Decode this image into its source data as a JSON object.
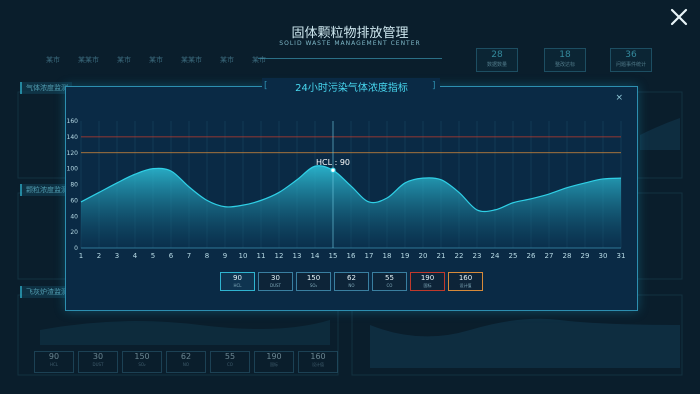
{
  "header": {
    "title": "固体颗粒物排放管理",
    "subtitle": "SOLID WASTE MANAGEMENT CENTER"
  },
  "city_nav": [
    "某市",
    "某某市",
    "某市",
    "某市",
    "某某市",
    "某市",
    "某市"
  ],
  "stats": [
    {
      "value": "28",
      "label": "数据数量"
    },
    {
      "value": "18",
      "label": "整改达标"
    },
    {
      "value": "36",
      "label": "问题事件统计"
    }
  ],
  "panels": {
    "left_1": "气体浓度监测",
    "left_2": "颗粒浓度监测",
    "left_3": "飞灰炉渣监测"
  },
  "modal": {
    "title": "24小时污染气体浓度指标",
    "close": "×",
    "tooltip": "HCL : 90"
  },
  "metrics": [
    {
      "value": "90",
      "name": "HCL",
      "state": "active"
    },
    {
      "value": "30",
      "name": "DUST",
      "state": "normal"
    },
    {
      "value": "150",
      "name": "SO₂",
      "state": "normal"
    },
    {
      "value": "62",
      "name": "NO",
      "state": "normal"
    },
    {
      "value": "55",
      "name": "CO",
      "state": "normal"
    },
    {
      "value": "190",
      "name": "国标",
      "state": "red"
    },
    {
      "value": "160",
      "name": "设计值",
      "state": "orange"
    }
  ],
  "bg_metrics": [
    {
      "value": "90",
      "name": "HCL"
    },
    {
      "value": "30",
      "name": "DUST"
    },
    {
      "value": "150",
      "name": "SO₂"
    },
    {
      "value": "62",
      "name": "NO"
    },
    {
      "value": "55",
      "name": "CO"
    },
    {
      "value": "190",
      "name": "国标"
    },
    {
      "value": "160",
      "name": "设计值"
    }
  ],
  "colors": {
    "accent": "#48d8f0",
    "line": "#2fd0e6",
    "threshold_red": "#c0392b",
    "threshold_orange": "#d68a3a"
  },
  "chart_data": {
    "type": "area",
    "x": [
      1,
      2,
      3,
      4,
      5,
      6,
      7,
      8,
      9,
      10,
      11,
      12,
      13,
      14,
      15,
      16,
      17,
      18,
      19,
      20,
      21,
      22,
      23,
      24,
      25,
      26,
      27,
      28,
      29,
      30,
      31
    ],
    "series": [
      {
        "name": "HCL",
        "values": [
          58,
          70,
          82,
          93,
          100,
          97,
          77,
          60,
          52,
          54,
          60,
          70,
          86,
          103,
          98,
          78,
          58,
          63,
          82,
          88,
          86,
          70,
          48,
          48,
          57,
          62,
          68,
          76,
          82,
          87,
          88
        ]
      }
    ],
    "thresholds": [
      {
        "name": "国标",
        "value": 140,
        "color": "#c0392b"
      },
      {
        "name": "设计值",
        "value": 120,
        "color": "#d68a3a"
      }
    ],
    "ylim": [
      0,
      160
    ],
    "yticks": [
      0,
      20,
      40,
      60,
      80,
      100,
      120,
      140,
      160
    ],
    "tooltip_x": 15,
    "grid": true
  }
}
